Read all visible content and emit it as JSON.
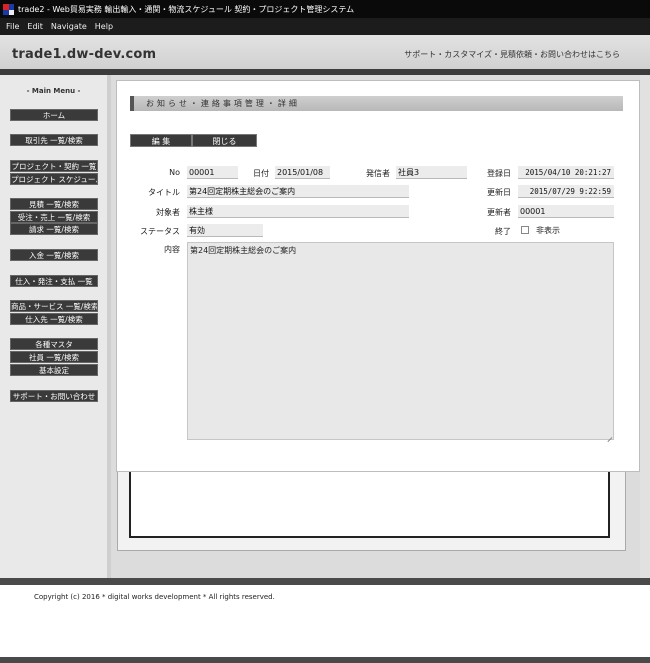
{
  "window": {
    "title": "trade2 - Web貿易実務 輸出輸入・通関・物流スケジュール 契約・プロジェクト管理システム"
  },
  "menubar": [
    "File",
    "Edit",
    "Navigate",
    "Help"
  ],
  "header": {
    "site_name": "trade1.dw-dev.com",
    "links": "サポート・カスタマイズ・見積依頼・お問い合わせはこちら"
  },
  "sidebar": {
    "title": "- Main Menu -",
    "items": [
      "ホーム",
      "取引先 一覧/検索",
      "プロジェクト・契約 一覧",
      "プロジェクト スケジュール",
      "見積 一覧/検索",
      "受注・売上 一覧/検索",
      "請求 一覧/検索",
      "入金 一覧/検索",
      "仕入・発注・支払 一覧",
      "商品・サービス 一覧/検索",
      "仕入先 一覧/検索",
      "各種マスタ",
      "社員 一覧/検索",
      "基本設定",
      "サポート・お問い合わせ"
    ]
  },
  "page": {
    "section_title": "お知らせ・連絡事項管理・詳細",
    "buttons": {
      "edit": "編 集",
      "close": "閉じる"
    }
  },
  "form": {
    "no_label": "No",
    "no_value": "00001",
    "date_label": "日付",
    "date_value": "2015/01/08",
    "sender_label": "発信者",
    "sender_value": "社員3",
    "registered_label": "登録日",
    "registered_value": "2015/04/10 20:21:27",
    "title_label": "タイトル",
    "title_value": "第24回定期株主総会のご案内",
    "updated_label": "更新日",
    "updated_value": "2015/07/29 9:22:59",
    "target_label": "対象者",
    "target_value": "株主様",
    "updater_label": "更新者",
    "updater_value": "00001",
    "status_label": "ステータス",
    "status_value": "有効",
    "finished_label": "終了",
    "hidden_label": "非表示",
    "content_label": "内容",
    "content_value": "第24回定期株主総会のご案内"
  },
  "footer": {
    "copyright": "Copyright (c) 2016 * digital works development * All rights reserved."
  }
}
